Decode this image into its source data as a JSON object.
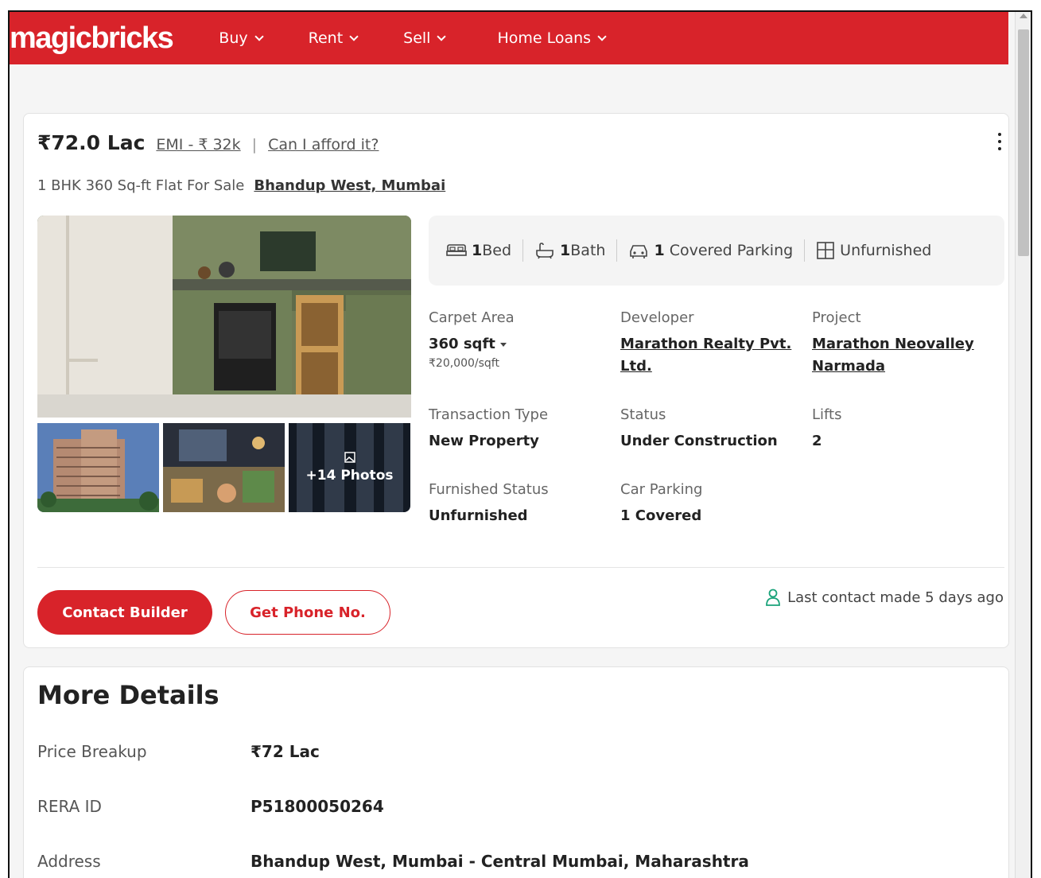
{
  "header": {
    "logo": "magicbricks",
    "nav": [
      {
        "label": "Buy"
      },
      {
        "label": "Rent"
      },
      {
        "label": "Sell"
      },
      {
        "label": "Home Loans"
      }
    ]
  },
  "listing": {
    "price": "₹72.0 Lac",
    "emi": "EMI - ₹ 32k",
    "pipe": "|",
    "afford": "Can I afford it?",
    "title": "1 BHK 360 Sq-ft Flat For Sale",
    "location": "Bhandup West, Mumbai",
    "photos_more": "+14 Photos",
    "features": {
      "bed_count": "1",
      "bed_label": "Bed",
      "bath_count": "1",
      "bath_label": "Bath",
      "parking_count": "1",
      "parking_label": "Covered Parking",
      "furnishing": "Unfurnished"
    },
    "details": {
      "carpet_area_label": "Carpet Area",
      "carpet_area_value": "360 sqft",
      "carpet_area_rate": "₹20,000/sqft",
      "developer_label": "Developer",
      "developer_value": "Marathon Realty Pvt. Ltd.",
      "project_label": "Project",
      "project_value": "Marathon Neovalley Narmada",
      "transaction_label": "Transaction Type",
      "transaction_value": "New Property",
      "status_label": "Status",
      "status_value": "Under Construction",
      "lifts_label": "Lifts",
      "lifts_value": "2",
      "furnished_label": "Furnished Status",
      "furnished_value": "Unfurnished",
      "car_parking_label": "Car Parking",
      "car_parking_value": "1 Covered"
    },
    "actions": {
      "contact_builder": "Contact Builder",
      "get_phone": "Get Phone No.",
      "last_contact": "Last contact made 5 days ago"
    }
  },
  "more_details": {
    "title": "More Details",
    "rows": [
      {
        "label": "Price Breakup",
        "value": "₹72 Lac"
      },
      {
        "label": "RERA ID",
        "value": "P51800050264"
      },
      {
        "label": "Address",
        "value": "Bhandup West, Mumbai - Central Mumbai, Maharashtra"
      }
    ]
  },
  "colors": {
    "brand_red": "#d8232a",
    "contact_icon": "#1aa37a"
  }
}
